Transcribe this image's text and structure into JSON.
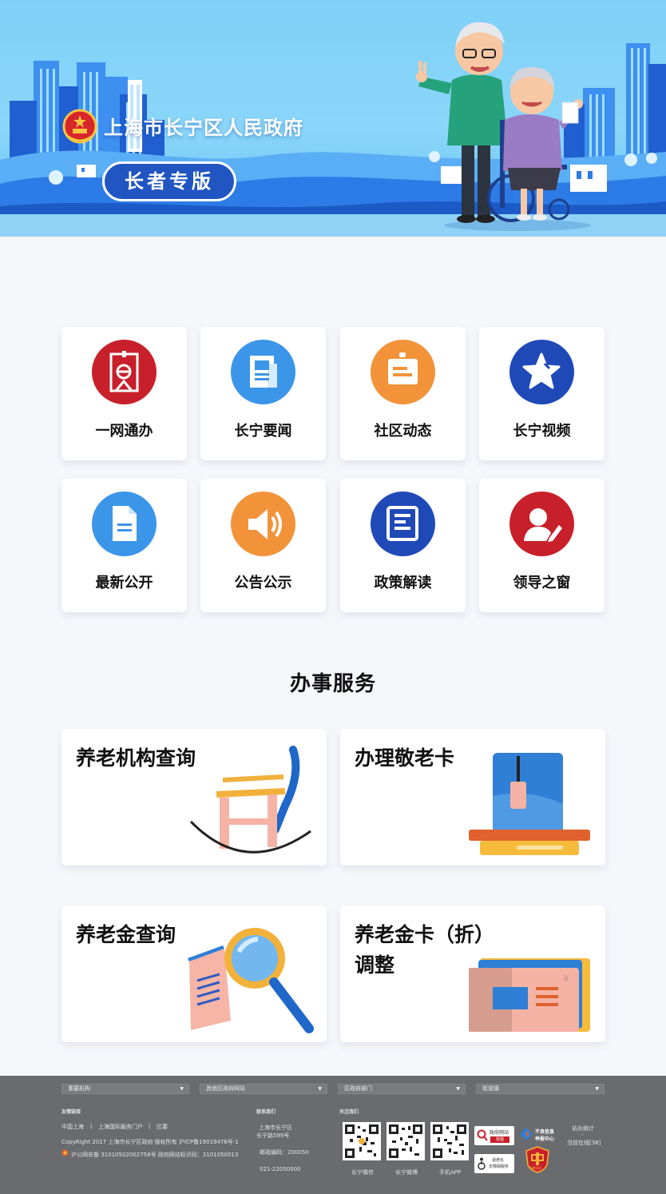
{
  "banner": {
    "site_title": "上海市长宁区人民政府",
    "elder_button": "长者专版"
  },
  "quick_links": [
    {
      "label": "一网通办",
      "icon": "yiwangtongban-e-icon",
      "color": "#c8202b"
    },
    {
      "label": "长宁要闻",
      "icon": "newspaper-icon",
      "color": "#3b95e8"
    },
    {
      "label": "社区动态",
      "icon": "community-board-icon",
      "color": "#f2933a"
    },
    {
      "label": "长宁视频",
      "icon": "star-icon",
      "color": "#2049b8"
    },
    {
      "label": "最新公开",
      "icon": "document-icon",
      "color": "#3b95e8"
    },
    {
      "label": "公告公示",
      "icon": "speaker-icon",
      "color": "#f2933a"
    },
    {
      "label": "政策解读",
      "icon": "book-icon",
      "color": "#2049b8"
    },
    {
      "label": "领导之窗",
      "icon": "leader-pen-icon",
      "color": "#c8202b"
    }
  ],
  "services": {
    "title": "办事服务",
    "cards": [
      {
        "title": "养老机构查询",
        "icon": "rocking-chair-illustration"
      },
      {
        "title": "办理敬老卡",
        "icon": "card-reader-illustration"
      },
      {
        "title": "养老金查询",
        "icon": "magnifier-illustration"
      },
      {
        "title_line1": "养老金卡（折）",
        "title_line2": "调整",
        "icon": "bankbook-illustration"
      }
    ]
  },
  "footer": {
    "selects": [
      "重要机构",
      "其他区政府网站",
      "区政府部门",
      "街道镇"
    ],
    "friend_links_heading": "友情链接",
    "links": [
      "中国上海",
      "上海国际服务门户",
      "区委"
    ],
    "copyright": "CopyRight 2017 上海市长宁区政府 版权所有 沪ICP备19019478号-1",
    "police_record": "沪公网安备 31010502002758号 政府网站标识码：3101050013",
    "contact_heading": "联系我们",
    "address_line1": "上海市长宁区",
    "address_line2": "长宁路599号",
    "postcode": "邮政编码：200050",
    "phone": "021-22050000",
    "follow_heading": "关注我们",
    "qr_labels": [
      "长宁微信",
      "长宁微博",
      "手机APP"
    ],
    "badge_gov_line1": "政府网站",
    "badge_gov_line2": "找错",
    "badge_report_line1": "不良信息",
    "badge_report_line2": "举报中心",
    "badge_access_line1": "适老化",
    "badge_access_line2": "无障碍服务",
    "badge_police": "党政机关",
    "stats_title": "站长统计",
    "stats_online": "当前在线[38]"
  }
}
